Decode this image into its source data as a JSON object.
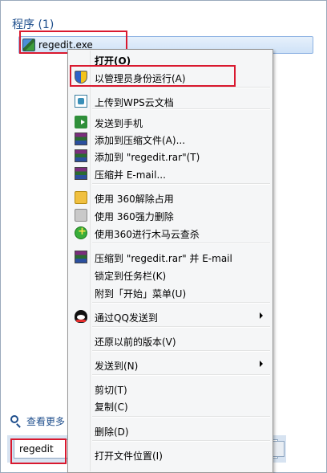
{
  "start_menu": {
    "section_title": "程序 (1)",
    "result_label": "regedit.exe",
    "see_more": "查看更多",
    "search_value": "regedit"
  },
  "context_menu": {
    "items": [
      {
        "label": "打开(O)",
        "icon": "",
        "bold": true
      },
      {
        "label": "以管理员身份运行(A)",
        "icon": "uac-shield-icon"
      },
      {
        "label": "上传到WPS云文档",
        "icon": "wps-cloud-icon"
      },
      {
        "label": "发送到手机",
        "icon": "send-to-phone-icon"
      },
      {
        "label": "添加到压缩文件(A)...",
        "icon": "winrar-icon"
      },
      {
        "label": "添加到 \"regedit.rar\"(T)",
        "icon": "winrar-icon"
      },
      {
        "label": "压缩并 E-mail...",
        "icon": "winrar-icon"
      },
      {
        "label": "使用 360解除占用",
        "icon": "360-unlock-icon"
      },
      {
        "label": "使用 360强力删除",
        "icon": "360-shredder-icon"
      },
      {
        "label": "使用360进行木马云查杀",
        "icon": "360-scan-icon"
      },
      {
        "label": "压缩到 \"regedit.rar\" 并 E-mail",
        "icon": "winrar-icon"
      },
      {
        "label": "锁定到任务栏(K)",
        "icon": ""
      },
      {
        "label": "附到「开始」菜单(U)",
        "icon": ""
      },
      {
        "label": "通过QQ发送到",
        "icon": "qq-icon",
        "submenu": true
      },
      {
        "label": "还原以前的版本(V)",
        "icon": ""
      },
      {
        "label": "发送到(N)",
        "icon": "",
        "submenu": true
      },
      {
        "label": "剪切(T)",
        "icon": ""
      },
      {
        "label": "复制(C)",
        "icon": ""
      },
      {
        "label": "删除(D)",
        "icon": ""
      },
      {
        "label": "打开文件位置(I)",
        "icon": ""
      }
    ]
  },
  "colors": {
    "highlight_box": "#d9192f",
    "title_blue": "#1e4e8c"
  }
}
